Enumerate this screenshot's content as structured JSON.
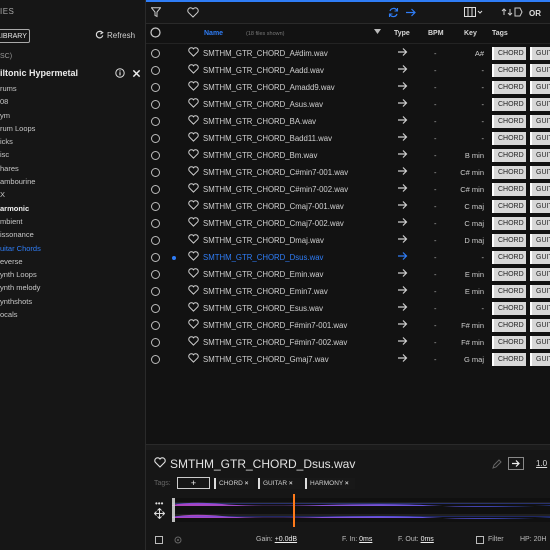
{
  "sidebar": {
    "header": "IES",
    "library_button": "LIBRARY",
    "refresh_label": "Refresh",
    "sort_label": "SC)",
    "pack_name": "iltonic Hypermetal",
    "categories": [
      {
        "label": "rums",
        "style": "normal"
      },
      {
        "label": "08",
        "style": "normal"
      },
      {
        "label": "ym",
        "style": "normal"
      },
      {
        "label": "rum Loops",
        "style": "normal"
      },
      {
        "label": "icks",
        "style": "normal"
      },
      {
        "label": "isc",
        "style": "normal"
      },
      {
        "label": "hares",
        "style": "normal"
      },
      {
        "label": "ambourine",
        "style": "normal"
      },
      {
        "label": "X",
        "style": "normal"
      },
      {
        "label": "armonic",
        "style": "bold"
      },
      {
        "label": "mbient",
        "style": "normal"
      },
      {
        "label": "issonance",
        "style": "normal"
      },
      {
        "label": "uitar Chords",
        "style": "active"
      },
      {
        "label": "everse",
        "style": "normal"
      },
      {
        "label": "ynth Loops",
        "style": "normal"
      },
      {
        "label": "ynth melody",
        "style": "normal"
      },
      {
        "label": "ynthshots",
        "style": "normal"
      },
      {
        "label": "ocals",
        "style": "normal"
      }
    ]
  },
  "topbar": {
    "sort_label": "OR"
  },
  "table": {
    "headers": {
      "name": "Name",
      "count": "(18 files shown)",
      "type": "Type",
      "bpm": "BPM",
      "key": "Key",
      "tags": "Tags"
    },
    "rows": [
      {
        "name": "SMTHM_GTR_CHORD_A#dim.wav",
        "bpm": "-",
        "key": "A#",
        "tag1": "CHORD",
        "tag2": "GUITAR",
        "selected": false
      },
      {
        "name": "SMTHM_GTR_CHORD_Aadd.wav",
        "bpm": "-",
        "key": "-",
        "tag1": "CHORD",
        "tag2": "GUITAR",
        "selected": false
      },
      {
        "name": "SMTHM_GTR_CHORD_Amadd9.wav",
        "bpm": "-",
        "key": "-",
        "tag1": "CHORD",
        "tag2": "GUITAR",
        "selected": false
      },
      {
        "name": "SMTHM_GTR_CHORD_Asus.wav",
        "bpm": "-",
        "key": "-",
        "tag1": "CHORD",
        "tag2": "GUITAR",
        "selected": false
      },
      {
        "name": "SMTHM_GTR_CHORD_BA.wav",
        "bpm": "-",
        "key": "-",
        "tag1": "CHORD",
        "tag2": "GUITAR",
        "selected": false
      },
      {
        "name": "SMTHM_GTR_CHORD_Badd11.wav",
        "bpm": "-",
        "key": "-",
        "tag1": "CHORD",
        "tag2": "GUITAR",
        "selected": false
      },
      {
        "name": "SMTHM_GTR_CHORD_Bm.wav",
        "bpm": "-",
        "key": "B min",
        "tag1": "CHORD",
        "tag2": "GUITAR",
        "selected": false
      },
      {
        "name": "SMTHM_GTR_CHORD_C#min7-001.wav",
        "bpm": "-",
        "key": "C# min",
        "tag1": "CHORD",
        "tag2": "GUITAR",
        "selected": false
      },
      {
        "name": "SMTHM_GTR_CHORD_C#min7-002.wav",
        "bpm": "-",
        "key": "C# min",
        "tag1": "CHORD",
        "tag2": "GUITAR",
        "selected": false
      },
      {
        "name": "SMTHM_GTR_CHORD_Cmaj7-001.wav",
        "bpm": "-",
        "key": "C maj",
        "tag1": "CHORD",
        "tag2": "GUITAR",
        "selected": false
      },
      {
        "name": "SMTHM_GTR_CHORD_Cmaj7-002.wav",
        "bpm": "-",
        "key": "C maj",
        "tag1": "CHORD",
        "tag2": "GUITAR",
        "selected": false
      },
      {
        "name": "SMTHM_GTR_CHORD_Dmaj.wav",
        "bpm": "-",
        "key": "D maj",
        "tag1": "CHORD",
        "tag2": "GUITAR",
        "selected": false
      },
      {
        "name": "SMTHM_GTR_CHORD_Dsus.wav",
        "bpm": "-",
        "key": "-",
        "tag1": "CHORD",
        "tag2": "GUITAR",
        "selected": true
      },
      {
        "name": "SMTHM_GTR_CHORD_Emin.wav",
        "bpm": "-",
        "key": "E min",
        "tag1": "CHORD",
        "tag2": "GUITAR",
        "selected": false
      },
      {
        "name": "SMTHM_GTR_CHORD_Emin7.wav",
        "bpm": "-",
        "key": "E min",
        "tag1": "CHORD",
        "tag2": "GUITAR",
        "selected": false
      },
      {
        "name": "SMTHM_GTR_CHORD_Esus.wav",
        "bpm": "-",
        "key": "-",
        "tag1": "CHORD",
        "tag2": "GUITAR",
        "selected": false
      },
      {
        "name": "SMTHM_GTR_CHORD_F#min7-001.wav",
        "bpm": "-",
        "key": "F# min",
        "tag1": "CHORD",
        "tag2": "GUITAR",
        "selected": false
      },
      {
        "name": "SMTHM_GTR_CHORD_F#min7-002.wav",
        "bpm": "-",
        "key": "F# min",
        "tag1": "CHORD",
        "tag2": "GUITAR",
        "selected": false
      },
      {
        "name": "SMTHM_GTR_CHORD_Gmaj7.wav",
        "bpm": "-",
        "key": "G maj",
        "tag1": "CHORD",
        "tag2": "GUITAR",
        "selected": false
      }
    ]
  },
  "panel": {
    "title": "SMTHM_GTR_CHORD_Dsus.wav",
    "tags_label": "Tags:",
    "add_label": "+",
    "tags": [
      "CHORD",
      "GUITAR",
      "HARMONY"
    ],
    "gain_label": "Gain:",
    "gain_value": "+0.0dB",
    "fadein_label": "F. In:",
    "fadein_value": "0ms",
    "fadeout_label": "F. Out:",
    "fadeout_value": "0ms",
    "filter_label": "Filter",
    "hp_label": "HP:",
    "hp_value": "20H",
    "page_label": "1.0"
  },
  "colors": {
    "accent": "#2f7df6",
    "playhead": "#ff7a1a",
    "wave": "#b04ad8"
  }
}
